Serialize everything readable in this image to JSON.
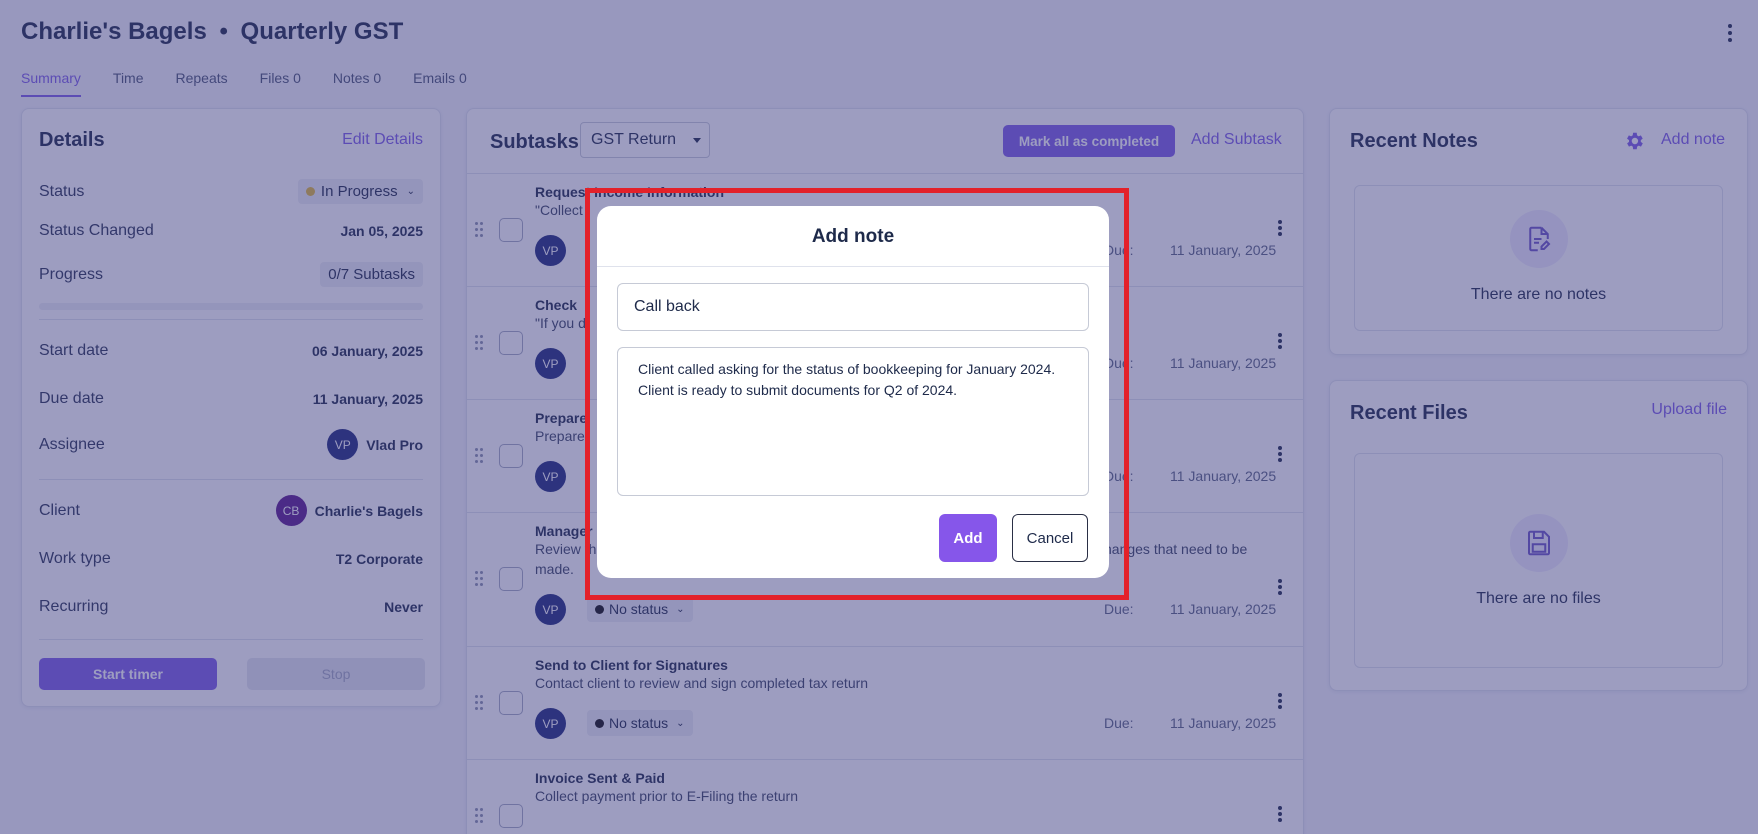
{
  "header": {
    "client_name": "Charlie's Bagels",
    "separator": "•",
    "job_name": "Quarterly GST"
  },
  "tabs": [
    {
      "label": "Summary",
      "active": true
    },
    {
      "label": "Time"
    },
    {
      "label": "Repeats"
    },
    {
      "label": "Files 0"
    },
    {
      "label": "Notes 0"
    },
    {
      "label": "Emails 0"
    }
  ],
  "details": {
    "title": "Details",
    "edit_label": "Edit Details",
    "status_label": "Status",
    "status_value": "In Progress",
    "status_changed_label": "Status Changed",
    "status_changed_value": "Jan 05, 2025",
    "progress_label": "Progress",
    "progress_value": "0/7 Subtasks",
    "progress_fraction": 0,
    "start_label": "Start date",
    "start_value": "06 January, 2025",
    "due_label": "Due date",
    "due_value": "11 January, 2025",
    "assignee_label": "Assignee",
    "assignee_initials": "VP",
    "assignee_name": "Vlad Pro",
    "client_label": "Client",
    "client_initials": "CB",
    "client_name": "Charlie's Bagels",
    "work_type_label": "Work type",
    "work_type_value": "T2 Corporate",
    "recurring_label": "Recurring",
    "recurring_value": "Never",
    "start_timer": "Start timer",
    "stop": "Stop"
  },
  "subtasks": {
    "title": "Subtasks",
    "filter_value": "GST Return",
    "mark_all": "Mark all as completed",
    "add_subtask": "Add Subtask",
    "due_label": "Due:",
    "rows": [
      {
        "title": "Request Income Information",
        "desc": "\"Collect",
        "assignee": "VP",
        "status": "",
        "due": "11 January, 2025"
      },
      {
        "title": "Check",
        "desc": "\"If you d",
        "assignee": "VP",
        "status": "",
        "due": "11 January, 2025"
      },
      {
        "title": "Prepare",
        "desc": "Prepare",
        "assignee": "VP",
        "status": "",
        "due": "11 January, 2025"
      },
      {
        "title": "Manager",
        "desc": "Review th",
        "desc_tail": "hanges that need to be",
        "desc2": "made.",
        "assignee": "VP",
        "status": "No status",
        "due": "11 January, 2025"
      },
      {
        "title": "Send to Client for Signatures",
        "desc": "Contact client to review and sign completed tax return",
        "assignee": "VP",
        "status": "No status",
        "due": "11 January, 2025"
      },
      {
        "title": "Invoice Sent & Paid",
        "desc": "Collect payment prior to E-Filing the return",
        "assignee": "VP",
        "status": "",
        "due": ""
      }
    ]
  },
  "notes": {
    "title": "Recent Notes",
    "add_note": "Add note",
    "empty_text": "There are no notes"
  },
  "files": {
    "title": "Recent Files",
    "upload": "Upload file",
    "empty_text": "There are no files"
  },
  "modal": {
    "title": "Add note",
    "title_value": "Call back",
    "body_value": "Client called asking for the status of bookkeeping for January 2024. Client is ready to submit documents for Q2 of 2024.",
    "add": "Add",
    "cancel": "Cancel"
  },
  "colors": {
    "accent": "#7c5ce6",
    "highlight": "#e3212a",
    "overlay": "rgba(60,60,130,0.5)"
  }
}
